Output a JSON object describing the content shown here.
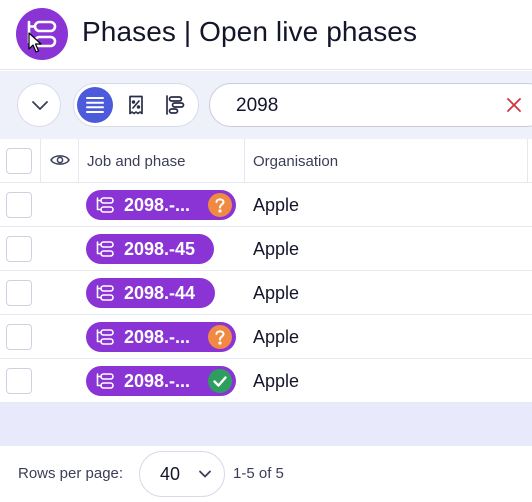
{
  "header": {
    "title": "Phases | Open live phases",
    "logo_icon": "phases-icon"
  },
  "toolbar": {
    "collapse_icon": "chevron-down-icon",
    "views": [
      {
        "name": "list-view",
        "icon": "list-lines-icon",
        "active": true
      },
      {
        "name": "receipt-percent-view",
        "icon": "receipt-percent-icon",
        "active": false
      },
      {
        "name": "timeline-view",
        "icon": "timeline-bars-icon",
        "active": false
      }
    ],
    "search": {
      "value": "2098",
      "clear_icon": "close-icon"
    }
  },
  "table": {
    "columns": [
      "Job and phase",
      "Organisation"
    ],
    "visibility_icon": "eye-icon",
    "rows": [
      {
        "job": "2098.-...",
        "status": "question",
        "organisation": "Apple"
      },
      {
        "job": "2098.-45",
        "status": "none",
        "organisation": "Apple"
      },
      {
        "job": "2098.-44",
        "status": "none",
        "organisation": "Apple"
      },
      {
        "job": "2098.-...",
        "status": "question",
        "organisation": "Apple"
      },
      {
        "job": "2098.-...",
        "status": "check",
        "organisation": "Apple"
      }
    ]
  },
  "footer": {
    "rows_per_page_label": "Rows per page:",
    "rows_per_page_value": "40",
    "range": "1-5 of 5"
  },
  "colors": {
    "accent": "#8a34d6",
    "active_view": "#4b5bdc",
    "question": "#f08a42",
    "ok": "#2e9e5e",
    "clear": "#d0343f"
  }
}
